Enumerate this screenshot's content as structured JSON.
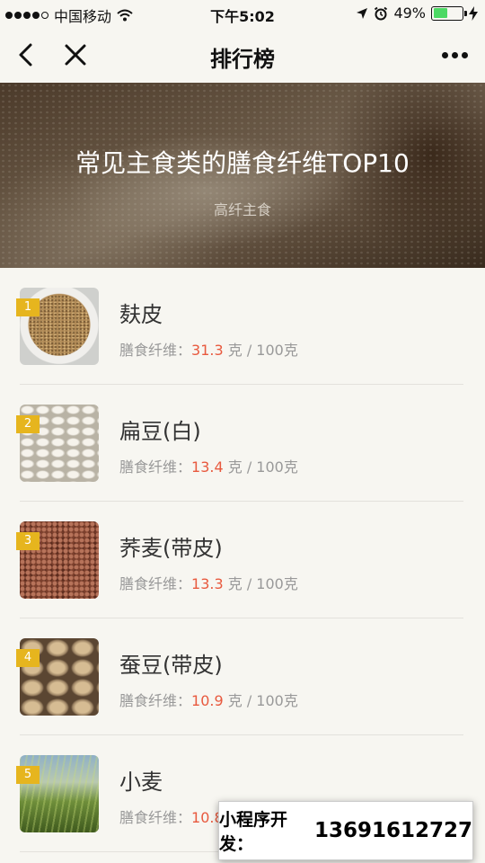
{
  "status_bar": {
    "carrier": "中国移动",
    "time": "下午5:02",
    "battery": "49%",
    "battery_level": 0.49,
    "icons": [
      "signal-dots-icon",
      "wifi-icon",
      "location-arrow-icon",
      "alarm-icon",
      "charging-bolt-icon"
    ]
  },
  "nav": {
    "title": "排行榜",
    "icons": [
      "back-chevron-icon",
      "close-icon",
      "more-dots-icon"
    ]
  },
  "banner": {
    "title": "常见主食类的膳食纤维TOP10",
    "subtitle": "高纤主食"
  },
  "list": {
    "items": [
      {
        "rank": "1",
        "name": "麸皮",
        "label": "膳食纤维：",
        "value": "31.3",
        "unit": "克 / 100克"
      },
      {
        "rank": "2",
        "name": "扁豆(白)",
        "label": "膳食纤维：",
        "value": "13.4",
        "unit": "克 / 100克"
      },
      {
        "rank": "3",
        "name": "荞麦(带皮)",
        "label": "膳食纤维：",
        "value": "13.3",
        "unit": "克 / 100克"
      },
      {
        "rank": "4",
        "name": "蚕豆(带皮)",
        "label": "膳食纤维：",
        "value": "10.9",
        "unit": "克 / 100克"
      },
      {
        "rank": "5",
        "name": "小麦",
        "label": "膳食纤维：",
        "value": "10.8",
        "unit": ""
      }
    ]
  },
  "watermark": {
    "label": "小程序开发：",
    "phone": "13691612727"
  },
  "colors": {
    "rank_badge": "#e6b51e",
    "value_highlight": "#e8593e",
    "background": "#f7f6f1"
  }
}
